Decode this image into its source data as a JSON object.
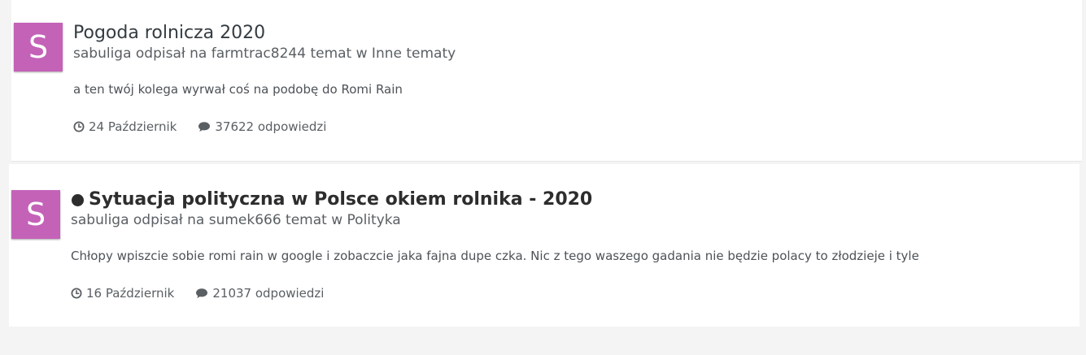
{
  "items": [
    {
      "avatar_letter": "S",
      "title": "Pogoda rolnicza 2020",
      "unread": false,
      "meta": "sabuliga odpisał na farmtrac8244 temat w Inne tematy",
      "snippet": "a ten twój kolega wyrwał coś na podobę do Romi Rain",
      "date": "24 Październik",
      "replies": "37622 odpowiedzi",
      "icons": {
        "date": "clock-icon",
        "replies": "comment-icon"
      }
    },
    {
      "avatar_letter": "S",
      "title": "Sytuacja polityczna w Polsce okiem rolnika - 2020",
      "unread": true,
      "meta": "sabuliga odpisał na sumek666 temat w Polityka",
      "snippet": "Chłopy wpiszcie sobie romi rain w google i zobaczcie jaka fajna dupe czka. Nic z tego waszego gadania nie będzie polacy to złodzieje i tyle",
      "date": "16 Październik",
      "replies": "21037 odpowiedzi",
      "icons": {
        "date": "clock-icon",
        "replies": "comment-icon"
      }
    }
  ],
  "colors": {
    "avatar_bg": "#c462b8",
    "page_bg": "#f4f4f4",
    "card_bg": "#ffffff",
    "text": "#353c41",
    "meta_text": "#5a5f63"
  }
}
